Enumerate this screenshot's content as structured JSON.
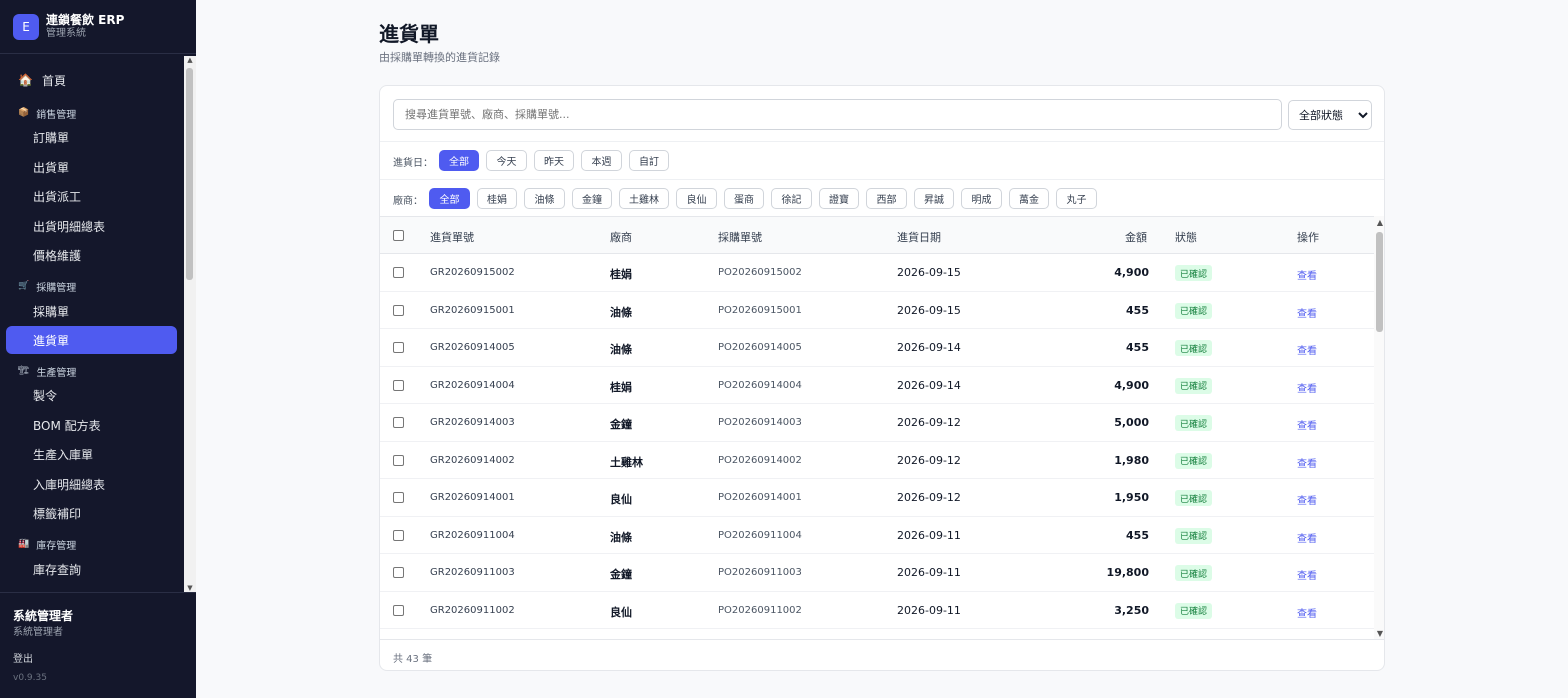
{
  "brand": {
    "logo": "E",
    "title": "連鎖餐飲 ERP",
    "subtitle": "管理系統"
  },
  "sidebar": {
    "home": {
      "label": "首頁",
      "icon": "home-icon"
    },
    "groups": [
      {
        "label": "銷售管理",
        "icon": "package-icon",
        "items": [
          "訂購單",
          "出貨單",
          "出貨派工",
          "出貨明細總表",
          "價格維護"
        ]
      },
      {
        "label": "採購管理",
        "icon": "cart-icon",
        "items": [
          "採購單",
          "進貨單"
        ]
      },
      {
        "label": "生產管理",
        "icon": "factory-icon",
        "items": [
          "製令",
          "BOM 配方表",
          "生產入庫單",
          "入庫明細總表",
          "標籤補印"
        ]
      },
      {
        "label": "庫存管理",
        "icon": "warehouse-icon",
        "items": [
          "庫存查詢"
        ]
      }
    ],
    "active": "進貨單"
  },
  "user": {
    "name": "系統管理者",
    "role": "系統管理者",
    "logout": "登出",
    "version": "v0.9.35"
  },
  "page": {
    "title": "進貨單",
    "subtitle": "由採購單轉換的進貨記錄"
  },
  "search": {
    "placeholder": "搜尋進貨單號、廠商、採購單號...",
    "value": ""
  },
  "status_filter": {
    "selected": "全部狀態"
  },
  "date_filter": {
    "label": "進貨日：",
    "options": [
      "全部",
      "今天",
      "昨天",
      "本週",
      "自訂"
    ],
    "active": "全部"
  },
  "vendor_filter": {
    "label": "廠商：",
    "options": [
      "全部",
      "桂娟",
      "油條",
      "金鐘",
      "土雞林",
      "良仙",
      "蛋商",
      "徐記",
      "證寶",
      "西部",
      "昇誠",
      "明成",
      "萬金",
      "丸子"
    ],
    "active": "全部"
  },
  "table": {
    "headers": {
      "gr_no": "進貨單號",
      "vendor": "廠商",
      "po_no": "採購單號",
      "date": "進貨日期",
      "amount": "金額",
      "status": "狀態",
      "action": "操作"
    },
    "rows": [
      {
        "gr_no": "GR20260915002",
        "vendor": "桂娟",
        "po_no": "PO20260915002",
        "date": "2026-09-15",
        "amount": "4,900",
        "status": "已確認",
        "action": "查看"
      },
      {
        "gr_no": "GR20260915001",
        "vendor": "油條",
        "po_no": "PO20260915001",
        "date": "2026-09-15",
        "amount": "455",
        "status": "已確認",
        "action": "查看"
      },
      {
        "gr_no": "GR20260914005",
        "vendor": "油條",
        "po_no": "PO20260914005",
        "date": "2026-09-14",
        "amount": "455",
        "status": "已確認",
        "action": "查看"
      },
      {
        "gr_no": "GR20260914004",
        "vendor": "桂娟",
        "po_no": "PO20260914004",
        "date": "2026-09-14",
        "amount": "4,900",
        "status": "已確認",
        "action": "查看"
      },
      {
        "gr_no": "GR20260914003",
        "vendor": "金鐘",
        "po_no": "PO20260914003",
        "date": "2026-09-12",
        "amount": "5,000",
        "status": "已確認",
        "action": "查看"
      },
      {
        "gr_no": "GR20260914002",
        "vendor": "土雞林",
        "po_no": "PO20260914002",
        "date": "2026-09-12",
        "amount": "1,980",
        "status": "已確認",
        "action": "查看"
      },
      {
        "gr_no": "GR20260914001",
        "vendor": "良仙",
        "po_no": "PO20260914001",
        "date": "2026-09-12",
        "amount": "1,950",
        "status": "已確認",
        "action": "查看"
      },
      {
        "gr_no": "GR20260911004",
        "vendor": "油條",
        "po_no": "PO20260911004",
        "date": "2026-09-11",
        "amount": "455",
        "status": "已確認",
        "action": "查看"
      },
      {
        "gr_no": "GR20260911003",
        "vendor": "金鐘",
        "po_no": "PO20260911003",
        "date": "2026-09-11",
        "amount": "19,800",
        "status": "已確認",
        "action": "查看"
      },
      {
        "gr_no": "GR20260911002",
        "vendor": "良仙",
        "po_no": "PO20260911002",
        "date": "2026-09-11",
        "amount": "3,250",
        "status": "已確認",
        "action": "查看"
      }
    ]
  },
  "footer": {
    "total": "共 43 筆"
  },
  "colors": {
    "accent": "#4f5bf0",
    "sidebar_bg": "#14172b",
    "status_bg": "#dcfce7",
    "status_text": "#15803d"
  }
}
